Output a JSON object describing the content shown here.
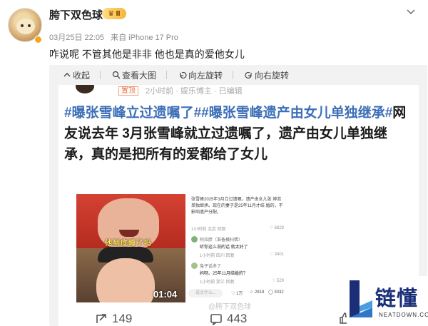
{
  "post": {
    "username": "胯下双色球",
    "vip_badge": "Ⅱ",
    "timestamp": "03月25日 22:05",
    "source": "来自 iPhone 17 Pro",
    "text": "咋说呢 不管其他是非非 他也是真的爱他女儿"
  },
  "viewer": {
    "toolbar": [
      {
        "icon": "collapse-icon",
        "label": "收起"
      },
      {
        "icon": "search-icon",
        "label": "查看大图"
      },
      {
        "icon": "rotate-left-icon",
        "label": "向左旋转"
      },
      {
        "icon": "rotate-right-icon",
        "label": "向右旋转"
      }
    ]
  },
  "screenshot": {
    "tag": "置顶",
    "source_fragment": "2小时前 · 娱乐博主 · 已编辑",
    "title_topic_1": "#曝张雪峰立过遗嘱了#",
    "title_topic_2": "#曝张雪峰遗产由女儿单独继承#",
    "title_body": "网友说去年 3月张雪峰就立过遗嘱了，遗产由女儿单独继承，真的是把所有的爱都给了女儿",
    "video": {
      "caption": "他到底睡了吗",
      "duration": "01:04"
    },
    "comments": {
      "lead": "张雪峰2025年3月立过遗嘱，遗产由女儿张 婷蕊单独继承。现在的妻子是25年11月才结 婚的，不影响遗产分配。",
      "lead_meta": "1小时前 北京  回复",
      "lead_likes": "6829",
      "items": [
        {
          "name": "阿拉胖（准备横扫情）",
          "text": "听你这么说的话 就太好了",
          "meta": "1小时前 四川  回复",
          "likes": "3401"
        },
        {
          "name": "兔子话多了",
          "text": "妈呀。25年11月结婚的？",
          "meta": "1小时前 浙江  回复",
          "likes": "529"
        }
      ],
      "input_placeholder": "说点什么...",
      "footer": {
        "likes": "1万",
        "favorites": "2818",
        "comments": "3032"
      }
    },
    "watermark": "@胯下双色球",
    "actions": {
      "reposts": "149",
      "comments": "443"
    }
  },
  "logo": {
    "text": "链懂",
    "sub": "NEATDOWN.COM"
  },
  "colors": {
    "topic_blue": "#3d6fb6",
    "logo_navy": "#1a2f78",
    "vip_gold": "#f5b63c"
  }
}
